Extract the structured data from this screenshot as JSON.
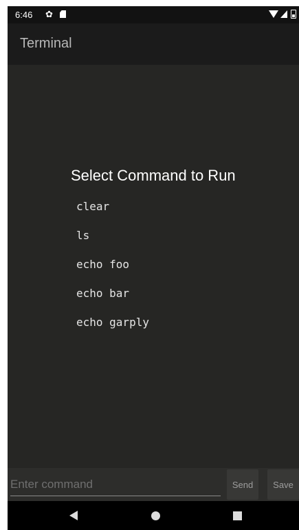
{
  "status_bar": {
    "time": "6:46",
    "icons": [
      "gear-icon",
      "sd-card-icon",
      "wifi-icon",
      "signal-icon",
      "battery-icon"
    ]
  },
  "app_bar": {
    "title": "Terminal"
  },
  "dialog": {
    "title": "Select Command to Run",
    "commands": [
      "clear",
      "ls",
      "echo foo",
      "echo bar",
      "echo garply"
    ]
  },
  "input_bar": {
    "placeholder": "Enter command",
    "value": "",
    "send_label": "Send",
    "save_label": "Save"
  },
  "nav_bar": {
    "icons": [
      "back-icon",
      "home-icon",
      "recents-icon"
    ]
  },
  "colors": {
    "background": "#262624",
    "app_bar": "#1b1b1b",
    "status_bar": "#121212",
    "text": "#ffffff"
  }
}
